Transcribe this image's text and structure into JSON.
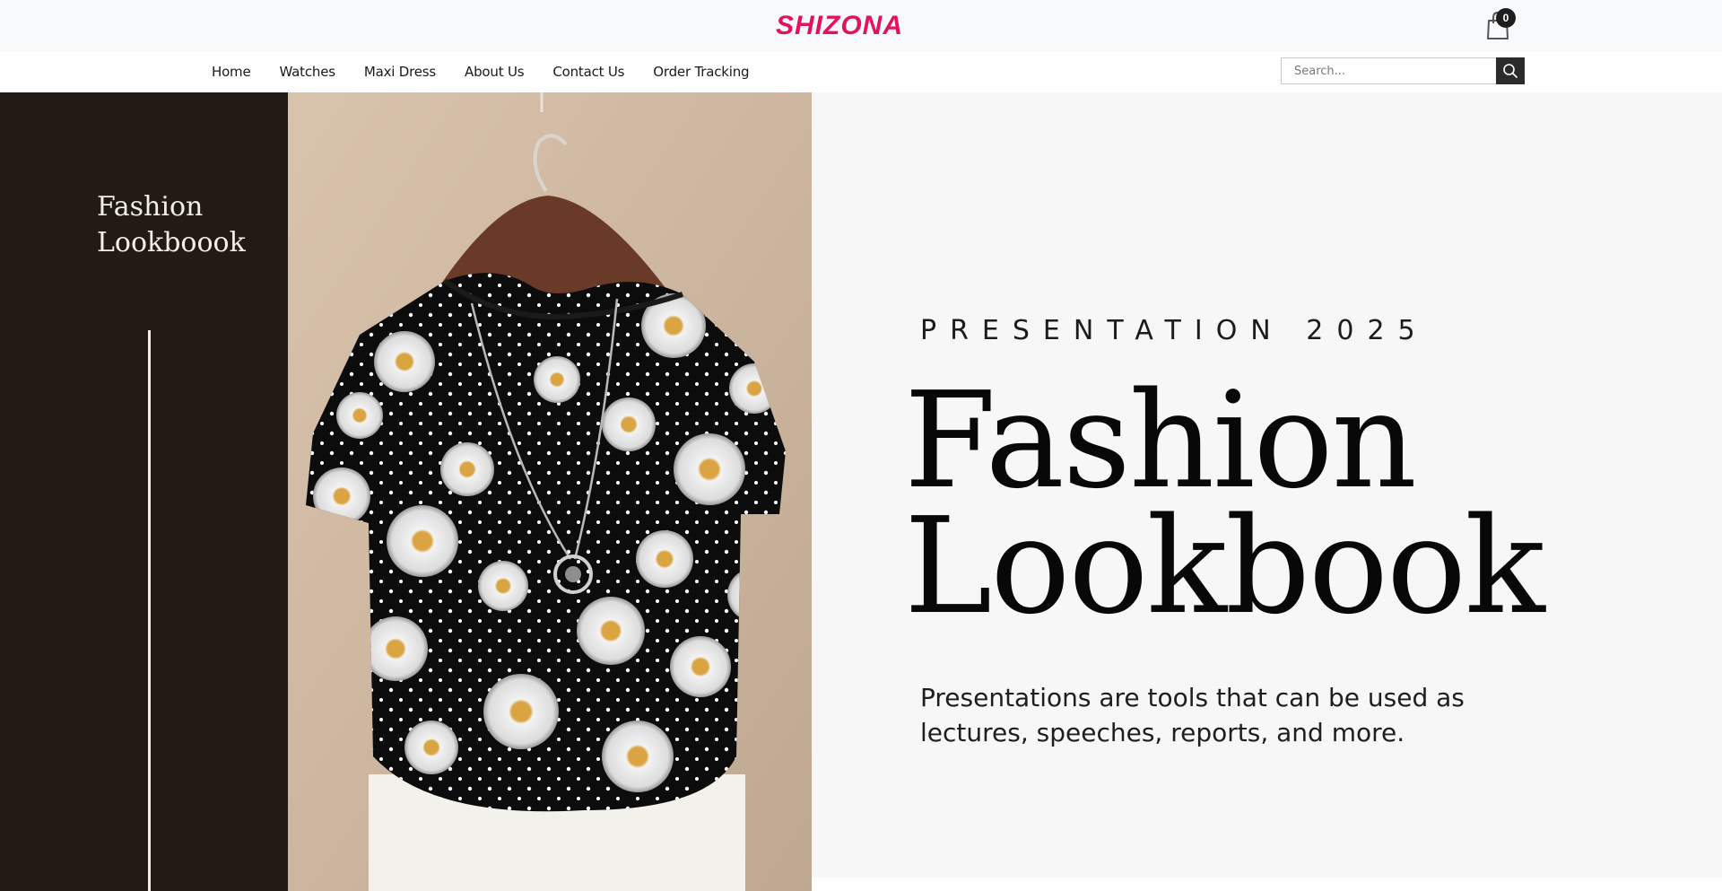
{
  "brand": {
    "name": "SHIZONA",
    "color": "#e3125f"
  },
  "cart": {
    "count": "0",
    "icon": "shopping-bag-icon"
  },
  "nav": {
    "items": [
      "Home",
      "Watches",
      "Maxi Dress",
      "About Us",
      "Contact Us",
      "Order Tracking"
    ]
  },
  "search": {
    "placeholder": "Search...",
    "value": "",
    "icon": "search-icon"
  },
  "hero": {
    "side_title": "Fashion Lookboook",
    "eyebrow": "PRESENTATION 2025",
    "title_line1": "Fashion",
    "title_line2": "Lookbook",
    "description": "Presentations are tools that can be used as lectures, speeches, reports, and more.",
    "image": "floral-blouse-photo"
  },
  "colors": {
    "panel_dark": "#221b15",
    "hero_background": "#f7f7f7",
    "text_dark": "#080808"
  }
}
